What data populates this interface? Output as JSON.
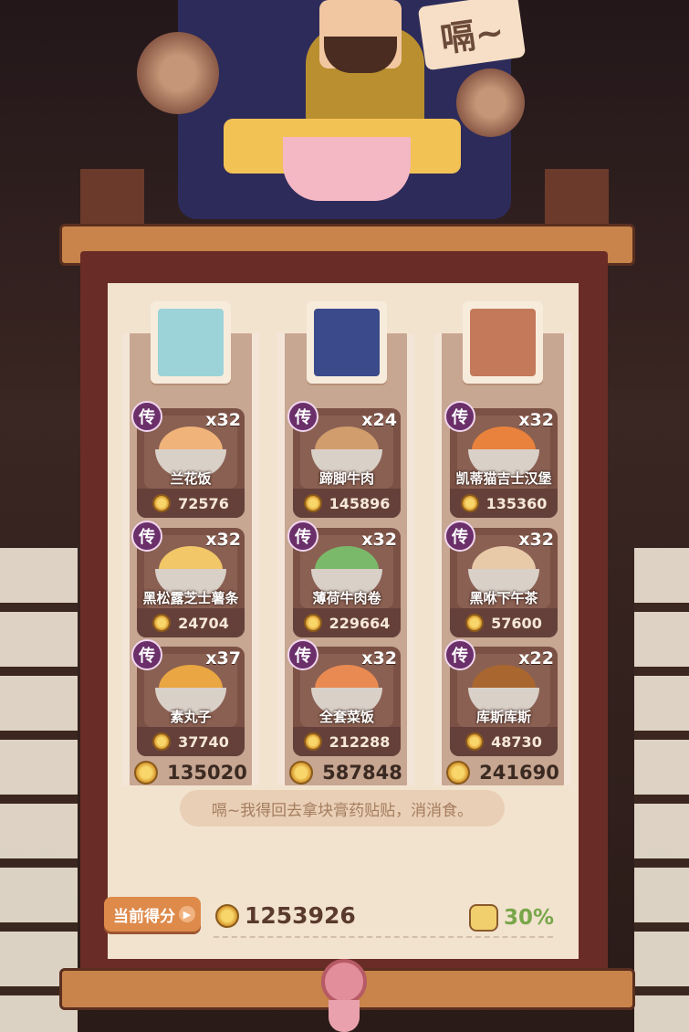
{
  "speech_bubble": "嗝~",
  "columns": [
    {
      "character": "portrait-blonde-heroine",
      "dishes": [
        {
          "badge": "传",
          "count": "x32",
          "name": "兰花饭",
          "price": "72576",
          "food_color": "#f0b47a"
        },
        {
          "badge": "传",
          "count": "x32",
          "name": "黑松露芝士薯条",
          "price": "24704",
          "food_color": "#f1c768"
        },
        {
          "badge": "传",
          "count": "x37",
          "name": "素丸子",
          "price": "37740",
          "food_color": "#e9a642"
        }
      ],
      "total": "135020",
      "portrait_color": "#9cd3d9"
    },
    {
      "character": "portrait-dark-haired-hero",
      "dishes": [
        {
          "badge": "传",
          "count": "x24",
          "name": "蹄脚牛肉",
          "price": "145896",
          "food_color": "#d19d6d"
        },
        {
          "badge": "传",
          "count": "x32",
          "name": "薄荷牛肉卷",
          "price": "229664",
          "food_color": "#7bb96a"
        },
        {
          "badge": "传",
          "count": "x32",
          "name": "全套菜饭",
          "price": "212288",
          "food_color": "#e88a52"
        }
      ],
      "total": "587848",
      "portrait_color": "#3b4a8a"
    },
    {
      "character": "portrait-bear-character",
      "dishes": [
        {
          "badge": "传",
          "count": "x32",
          "name": "凯蒂猫吉士汉堡",
          "price": "135360",
          "food_color": "#e8823c"
        },
        {
          "badge": "传",
          "count": "x32",
          "name": "黑咻下午茶",
          "price": "57600",
          "food_color": "#e8c9a8"
        },
        {
          "badge": "传",
          "count": "x22",
          "name": "库斯库斯",
          "price": "48730",
          "food_color": "#a9672f"
        }
      ],
      "total": "241690",
      "portrait_color": "#c4795a"
    }
  ],
  "dialog_text": "嗝~我得回去拿块膏药贴贴，消消食。",
  "score_label": "当前得分",
  "score_value": "1253926",
  "percent": "30%"
}
